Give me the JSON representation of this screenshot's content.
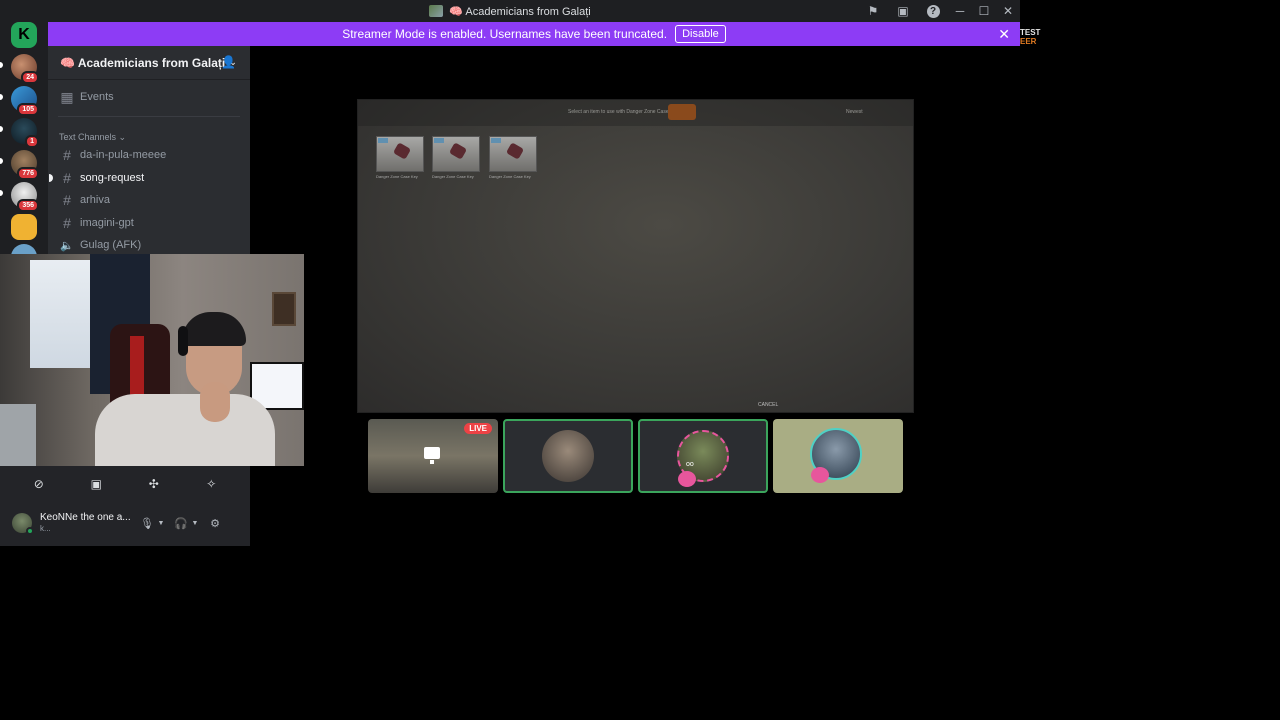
{
  "window": {
    "title": "🧠 Academicians from Galați",
    "inbox_icon": "inbox-flag-icon",
    "screen_icon": "screen-share-icon",
    "help_label": "?",
    "minimize": "─",
    "maximize": "☐",
    "close": "✕"
  },
  "banner": {
    "text": "Streamer Mode is enabled. Usernames have been truncated.",
    "button": "Disable",
    "close": "✕",
    "color": "#8d3cf5"
  },
  "server_rail": {
    "home_glyph": "K",
    "badges": [
      "24",
      "105",
      "1",
      "776",
      "356"
    ]
  },
  "sidebar": {
    "server_name": "🧠 Academicians from Galați",
    "server_chevron": "⌄",
    "events_label": "Events",
    "category": "Text Channels ⌄",
    "channels": [
      {
        "name": "da-in-pula-meeee",
        "type": "text"
      },
      {
        "name": "song-request",
        "type": "text",
        "active": true
      },
      {
        "name": "arhiva",
        "type": "text"
      },
      {
        "name": "imagini-gpt",
        "type": "text"
      },
      {
        "name": "Gulag (AFK)",
        "type": "voice"
      }
    ]
  },
  "user_panel": {
    "username": "KeoNNe the one a...",
    "status": "k...",
    "controls": [
      "camera-off-icon",
      "screen-share-icon",
      "activities-icon",
      "soundboard-icon"
    ]
  },
  "stream": {
    "header_text": "Select an item to use with Danger Zone Case",
    "sort_label": "Newest",
    "items": [
      {
        "caption": "Danger Zone Case Key"
      },
      {
        "caption": "Danger Zone Case Key"
      },
      {
        "caption": "Danger Zone Case Key"
      }
    ],
    "cancel_label": "CANCEL"
  },
  "participants": {
    "live_badge": "LIVE"
  },
  "background_app": {
    "line1": "TEST",
    "line2": "EER"
  },
  "colors": {
    "accent": "#8d3cf5",
    "speaking": "#3ba55c",
    "live": "#ed4245",
    "badge": "#da373c"
  }
}
